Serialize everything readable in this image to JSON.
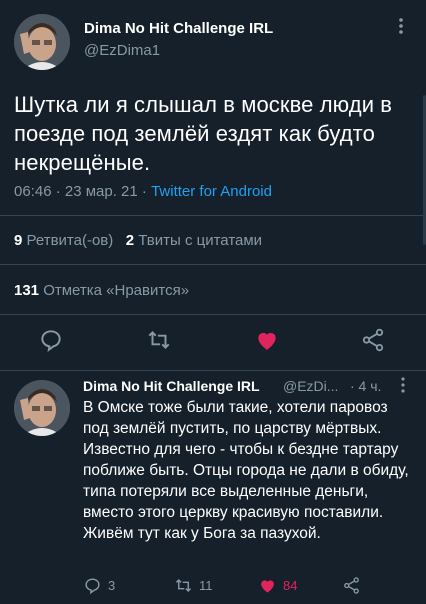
{
  "main_tweet": {
    "display_name": "Dima No Hit Challenge IRL",
    "handle": "@EzDima1",
    "text": "Шутка ли я слышал в москве люди в поезде под землёй ездят как будто некрещёные.",
    "time": "06:46 · 23 мар. 21 · ",
    "source": "Twitter for Android",
    "retweets_count": "9",
    "retweets_label": "Ретвита(-ов)",
    "quotes_count": "2",
    "quotes_label": "Твиты с цитатами",
    "likes_count": "131",
    "likes_label": "Отметка «Нравится»",
    "liked": true
  },
  "reply": {
    "display_name": "Dima No Hit Challenge IRL",
    "handle": "@EzDi...",
    "age": "· 4 ч.",
    "text": "В Омске тоже были такие, хотели паровоз под землёй пустить, по царству мёртвых. Известно для чего - чтобы к бездне тартару поближе быть. Отцы города не дали в обиду, типа потеряли все выделенные деньги, вместо этого церкву красивую поставили. Живём тут как у Бога за пазухой.",
    "reply_count": "3",
    "retweet_count": "11",
    "like_count": "84"
  },
  "colors": {
    "background": "#15202b",
    "muted": "#8899a6",
    "link": "#1da1f2",
    "like": "#e0245e"
  },
  "icons": [
    "more-icon",
    "reply-icon",
    "retweet-icon",
    "heart-icon",
    "share-icon"
  ]
}
